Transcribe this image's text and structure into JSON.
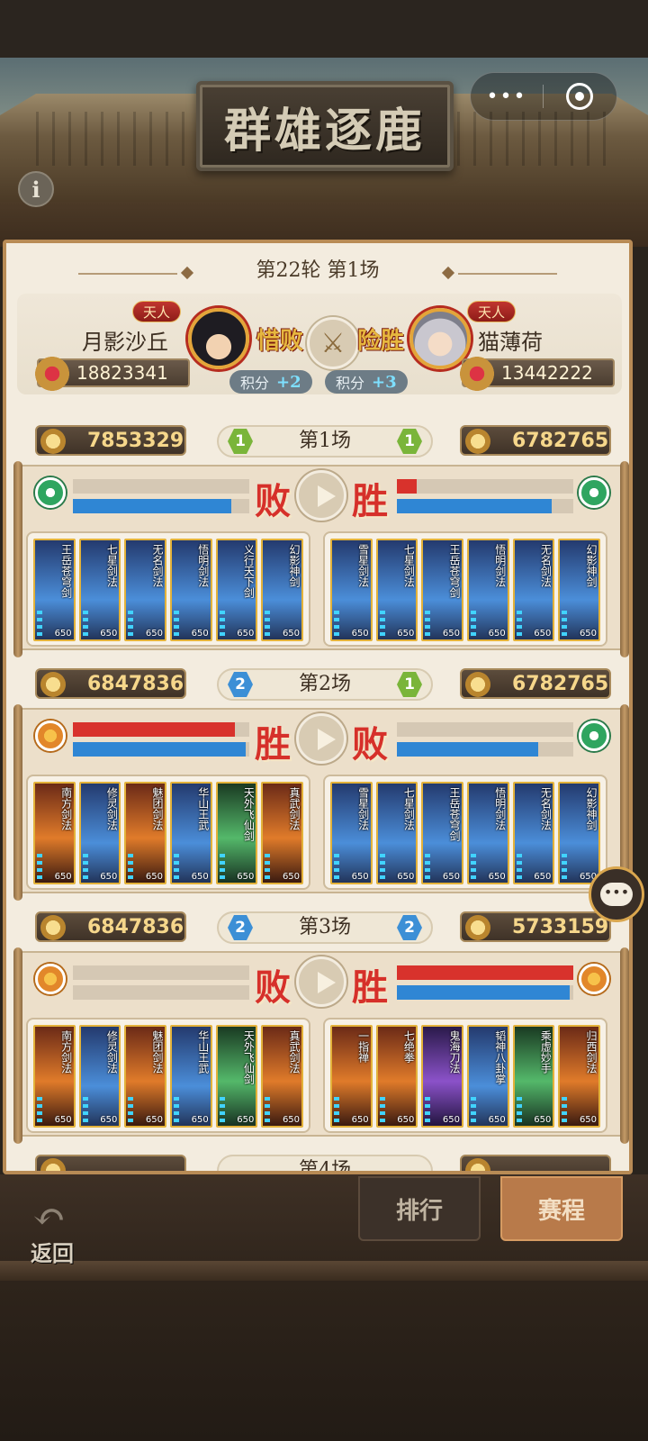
{
  "header": {
    "title": "群雄逐鹿",
    "more_icon": "•••",
    "info_icon": "i"
  },
  "round": {
    "title": "第22轮 第1场",
    "left_player": {
      "rank": "天人",
      "name": "月影沙丘",
      "result": "惜败",
      "score_label": "积分",
      "score_delta": "+2",
      "power": "18823341"
    },
    "right_player": {
      "rank": "天人",
      "name": "猫薄荷",
      "result": "险胜",
      "score_label": "积分",
      "score_delta": "+3",
      "power": "13442222"
    }
  },
  "matches": [
    {
      "label": "第1场",
      "left_power": "7853329",
      "right_power": "6782765",
      "left_num": "1",
      "right_num": "1",
      "left_result": "败",
      "right_result": "胜",
      "left_bars": {
        "red": 0.0,
        "blue": 0.9
      },
      "right_bars": {
        "red": 0.11,
        "blue": 0.88
      },
      "left_cards": [
        {
          "name": "王岳苍穹剑",
          "level": "650"
        },
        {
          "name": "七星剑法",
          "level": "650"
        },
        {
          "name": "无名剑法",
          "level": "650"
        },
        {
          "name": "悟明剑法",
          "level": "650"
        },
        {
          "name": "义行天下剑",
          "level": "650"
        },
        {
          "name": "幻影神剑",
          "level": "650"
        }
      ],
      "right_cards": [
        {
          "name": "雪星剑法",
          "level": "650"
        },
        {
          "name": "七星剑法",
          "level": "650"
        },
        {
          "name": "王岳苍穹剑",
          "level": "650"
        },
        {
          "name": "悟明剑法",
          "level": "650"
        },
        {
          "name": "无名剑法",
          "level": "650"
        },
        {
          "name": "幻影神剑",
          "level": "650"
        }
      ]
    },
    {
      "label": "第2场",
      "left_power": "6847836",
      "right_power": "6782765",
      "left_num": "2",
      "right_num": "1",
      "left_result": "胜",
      "right_result": "败",
      "left_bars": {
        "red": 0.92,
        "blue": 0.98
      },
      "right_bars": {
        "red": 0.0,
        "blue": 0.8
      },
      "left_cards": [
        {
          "name": "南方剑法",
          "level": "650"
        },
        {
          "name": "修灵剑法",
          "level": "650"
        },
        {
          "name": "魅团剑法",
          "level": "650"
        },
        {
          "name": "华山王武",
          "level": "650"
        },
        {
          "name": "天外飞仙剑",
          "level": "650"
        },
        {
          "name": "真武剑法",
          "level": "650"
        }
      ],
      "right_cards": [
        {
          "name": "雪星剑法",
          "level": "650"
        },
        {
          "name": "七星剑法",
          "level": "650"
        },
        {
          "name": "王岳苍穹剑",
          "level": "650"
        },
        {
          "name": "悟明剑法",
          "level": "650"
        },
        {
          "name": "无名剑法",
          "level": "650"
        },
        {
          "name": "幻影神剑",
          "level": "650"
        }
      ]
    },
    {
      "label": "第3场",
      "left_power": "6847836",
      "right_power": "5733159",
      "left_num": "2",
      "right_num": "2",
      "left_result": "败",
      "right_result": "胜",
      "left_bars": {
        "red": 0.0,
        "blue": 0.0
      },
      "right_bars": {
        "red": 1.0,
        "blue": 0.98
      },
      "left_cards": [
        {
          "name": "南方剑法",
          "level": "650"
        },
        {
          "name": "修灵剑法",
          "level": "650"
        },
        {
          "name": "魅团剑法",
          "level": "650"
        },
        {
          "name": "华山王武",
          "level": "650"
        },
        {
          "name": "天外飞仙剑",
          "level": "650"
        },
        {
          "name": "真武剑法",
          "level": "650"
        }
      ],
      "right_cards": [
        {
          "name": "一指禅",
          "level": "650"
        },
        {
          "name": "七绝拳",
          "level": "650"
        },
        {
          "name": "鬼海刀法",
          "level": "650"
        },
        {
          "name": "韬神八卦掌",
          "level": "650"
        },
        {
          "name": "乘虚妙手",
          "level": "650"
        },
        {
          "name": "归西剑法",
          "level": "650"
        }
      ]
    }
  ],
  "peek_match": {
    "label": "第4场"
  },
  "footer": {
    "back_label": "返回",
    "rank_tab": "排行",
    "schedule_tab": "赛程"
  },
  "colors": {
    "win_red": "#d6302a",
    "bar_red": "#d8322c",
    "bar_blue": "#2f86d4",
    "gold": "#e3b23a",
    "panel_bg": "#f3ecdf"
  }
}
